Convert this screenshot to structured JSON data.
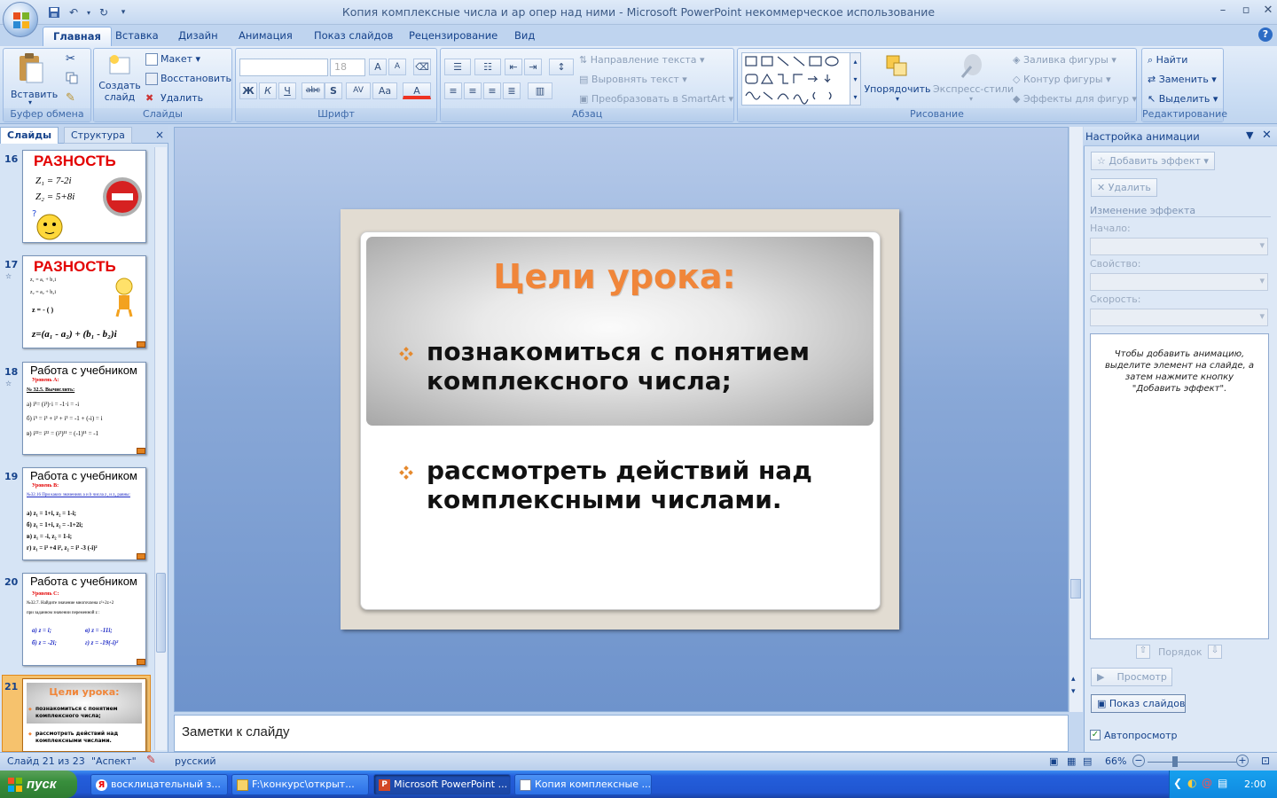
{
  "window": {
    "title": "Копия комплексные числа и ар опер над ними - Microsoft PowerPoint некоммерческое использование"
  },
  "tabs": [
    {
      "label": "Главная",
      "active": true
    },
    {
      "label": "Вставка"
    },
    {
      "label": "Дизайн"
    },
    {
      "label": "Анимация"
    },
    {
      "label": "Показ слайдов"
    },
    {
      "label": "Рецензирование"
    },
    {
      "label": "Вид"
    }
  ],
  "ribbon": {
    "clipboard": {
      "paste": "Вставить",
      "label": "Буфер обмена"
    },
    "slides": {
      "new_slide": "Создать слайд",
      "layout": "Макет",
      "reset": "Восстановить",
      "delete": "Удалить",
      "label": "Слайды"
    },
    "font": {
      "size": "18",
      "label": "Шрифт",
      "bold": "Ж",
      "italic": "К",
      "underline": "Ч",
      "strike": "abc",
      "shadow": "S",
      "spacing": "AV",
      "case": "Aa",
      "color": "A"
    },
    "paragraph": {
      "text_direction": "Направление текста",
      "align_text": "Выровнять текст",
      "smartart": "Преобразовать в SmartArt",
      "label": "Абзац"
    },
    "drawing": {
      "arrange": "Упорядочить",
      "quick_styles": "Экспресс-стили",
      "fill": "Заливка фигуры",
      "outline": "Контур фигуры",
      "effects": "Эффекты для фигур",
      "label": "Рисование"
    },
    "editing": {
      "find": "Найти",
      "replace": "Заменить",
      "select": "Выделить",
      "label": "Редактирование"
    }
  },
  "left_pane": {
    "tab_slides": "Слайды",
    "tab_outline": "Структура",
    "slides": [
      {
        "num": "16",
        "title": "РАЗНОСТЬ",
        "lines": [
          "Z₁ = 7-2i",
          "Z₂ = 5+8i"
        ]
      },
      {
        "num": "17",
        "title": "РАЗНОСТЬ",
        "lines": [
          "z₁ = a₁ + b₁i",
          "z₂ = a₂ + b₂i",
          "z =        - (         )",
          "z=(a₁ - a₂) + (b₁ - b₂)i"
        ]
      },
      {
        "num": "18",
        "title": "Работа с учебником",
        "lines": [
          "Уровень А:",
          "№ 32.5. Вычислить:",
          "а) i³= (i²)·i = -1·i = -i",
          "б) i⁵ = i³ + i² + i³ = -1 + (-i) = i",
          "в) i²²= i²² = (i²)¹¹ = (-1)¹¹ = -1"
        ]
      },
      {
        "num": "19",
        "title": "Работа с учебником",
        "lines": [
          "Уровень В:",
          "№32.16 При каких значениях а и b числа z₁ и z₂ равны:",
          "а) z₁ = 1+i,        z₂ = 1-i;",
          "б) z₁ = 1+i,        z₂ = -1+2i;",
          "в) z₁ = -i,          z₂ = 1-i;",
          "г) z₁ = i³ +4 i², z₂ = i³ -3 (-i)²"
        ]
      },
      {
        "num": "20",
        "title": "Работа с учебником",
        "lines": [
          "Уровень С:",
          "№32.7. Найдите значение многочлена z²+2z+2",
          "при заданном значении переменной z :",
          "а) z = i;",
          "б) z = -2i;",
          "в) z = -11i;",
          "г) z = -19(-i)²"
        ]
      },
      {
        "num": "21",
        "title": "Цели урока:",
        "lines": [
          "познакомиться с понятием комплексного числа;",
          "рассмотреть действий над комплексными числами."
        ]
      }
    ]
  },
  "slide": {
    "title": "Цели урока:",
    "bullets": [
      {
        "text": "познакомиться с понятием комплексного числа;"
      },
      {
        "text": "рассмотреть действий над комплексными числами."
      }
    ]
  },
  "notes": {
    "placeholder": "Заметки к слайду"
  },
  "right_pane": {
    "title": "Настройка анимации",
    "add_effect": "Добавить эффект",
    "remove": "Удалить",
    "change_effect": "Изменение эффекта",
    "start_label": "Начало:",
    "property_label": "Свойство:",
    "speed_label": "Скорость:",
    "hint": "Чтобы добавить анимацию, выделите элемент на слайде, а затем нажмите кнопку \"Добавить эффект\".",
    "order": "Порядок",
    "preview": "Просмотр",
    "slideshow": "Показ слайдов",
    "autopreview": "Автопросмотр"
  },
  "status": {
    "slide_info": "Слайд 21 из 23",
    "theme": "\"Аспект\"",
    "language": "русский",
    "zoom": "66%"
  },
  "taskbar": {
    "start": "пуск",
    "tasks": [
      {
        "label": "восклицательный з...",
        "icon": "yandex-icon"
      },
      {
        "label": "F:\\конкурс\\открыт...",
        "icon": "folder-icon"
      },
      {
        "label": "Microsoft PowerPoint ...",
        "icon": "powerpoint-icon"
      },
      {
        "label": "Копия комплексные ...",
        "icon": "document-icon"
      }
    ],
    "clock": "2:00"
  },
  "colors": {
    "accent_orange": "#f0863a",
    "ribbon_text": "#15428b"
  }
}
